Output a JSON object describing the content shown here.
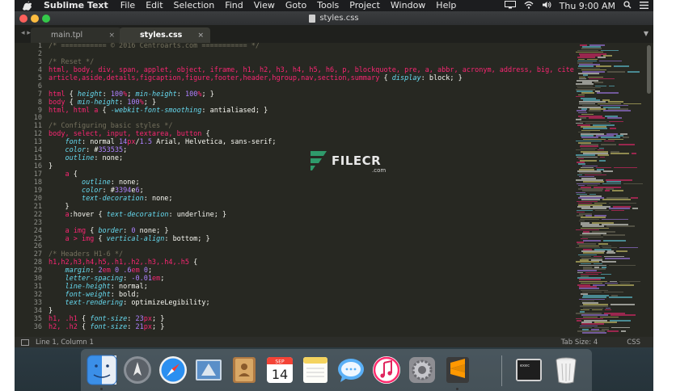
{
  "menubar": {
    "app_name": "Sublime Text",
    "menus": [
      "File",
      "Edit",
      "Selection",
      "Find",
      "View",
      "Goto",
      "Tools",
      "Project",
      "Window",
      "Help"
    ],
    "clock": "Thu 9:00 AM",
    "icons": [
      "apple-icon",
      "display-icon",
      "wifi-icon",
      "volume-icon",
      "search-icon",
      "list-icon"
    ]
  },
  "window": {
    "title": "styles.css",
    "tabs": [
      {
        "label": "main.tpl",
        "active": false
      },
      {
        "label": "styles.css",
        "active": true
      }
    ],
    "close_glyph": "×",
    "nav_glyph": "◂ ▸",
    "dropdown_glyph": "▼"
  },
  "editor": {
    "lines": [
      "/* =========== © 2016 Centroarts.com =========== */",
      "",
      "/* Reset */",
      "html, body, div, span, applet, object, iframe, h1, h2, h3, h4, h5, h6, p, blockquote, pre, a, abbr, acronym, address, big, cite, code,",
      "article,aside,details,figcaption,figure,footer,header,hgroup,nav,section,summary { display: block; }",
      "",
      "html { height: 100%; min-height: 100%; }",
      "body { min-height: 100%; }",
      "html, html a { -webkit-font-smoothing: antialiased; }",
      "",
      "/* Configuring basic styles */",
      "body, select, input, textarea, button {",
      "    font: normal 14px/1.5 Arial, Helvetica, sans-serif;",
      "    color: #353535;",
      "    outline: none;",
      "}",
      "    a {",
      "        outline: none;",
      "        color: #3394e6;",
      "        text-decoration: none;",
      "    }",
      "    a:hover { text-decoration: underline; }",
      "",
      "    a img { border: 0 none; }",
      "    a > img { vertical-align: bottom; }",
      "",
      "/* Headers H1-6 */",
      "h1,h2,h3,h4,h5,.h1,.h2,.h3,.h4,.h5 {",
      "    margin: 2em 0 .6em 0;",
      "    letter-spacing: -0.01em;",
      "    line-height: normal;",
      "    font-weight: bold;",
      "    text-rendering: optimizeLegibility;",
      "}",
      "h1, .h1 { font-size: 23px; }",
      "h2, .h2 { font-size: 21px; }"
    ]
  },
  "watermark": {
    "word": "FILECR",
    "sub": ".com"
  },
  "statusbar": {
    "position": "Line 1, Column 1",
    "tab_size": "Tab Size: 4",
    "syntax": "CSS"
  },
  "dock": {
    "items": [
      {
        "name": "finder-icon",
        "running": true
      },
      {
        "name": "launchpad-icon",
        "running": false
      },
      {
        "name": "safari-icon",
        "running": false
      },
      {
        "name": "mail-icon",
        "running": false
      },
      {
        "name": "contacts-icon",
        "running": false
      },
      {
        "name": "calendar-icon",
        "running": false,
        "month": "SEP",
        "day": "14"
      },
      {
        "name": "notes-icon",
        "running": false
      },
      {
        "name": "messages-icon",
        "running": false
      },
      {
        "name": "itunes-icon",
        "running": false
      },
      {
        "name": "system-preferences-icon",
        "running": false
      },
      {
        "name": "sublime-text-icon",
        "running": true
      },
      {
        "name": "terminal-icon",
        "running": false,
        "label": "exec"
      },
      {
        "name": "trash-icon",
        "running": false
      }
    ]
  },
  "colors": {
    "editor_bg": "#272822",
    "comment": "#75715e",
    "tag": "#f92672",
    "property": "#66d9ef",
    "number": "#ae81ff",
    "string": "#e6db74"
  }
}
